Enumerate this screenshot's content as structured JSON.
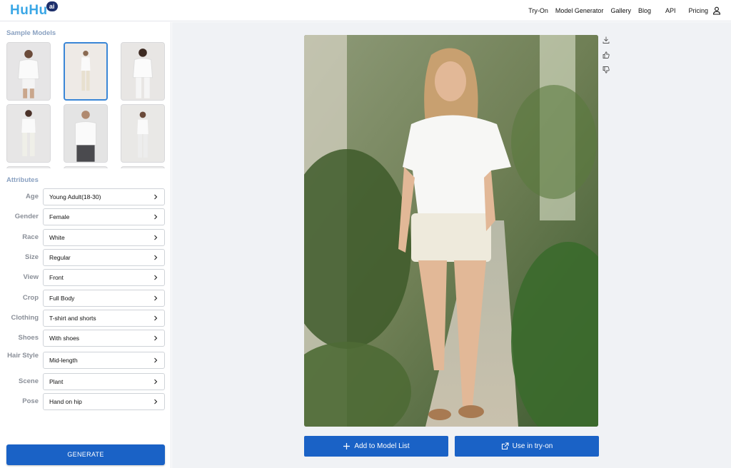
{
  "header": {
    "logo_text": "HuHu",
    "logo_badge": "ai",
    "nav": [
      "Try-On",
      "Model Generator",
      "Gallery",
      "Blog",
      "API",
      "Pricing"
    ]
  },
  "sidebar": {
    "sample_models_title": "Sample Models",
    "attributes_title": "Attributes",
    "attributes": [
      {
        "label": "Age",
        "value": "Young Adult(18-30)"
      },
      {
        "label": "Gender",
        "value": "Female"
      },
      {
        "label": "Race",
        "value": "White"
      },
      {
        "label": "Size",
        "value": "Regular"
      },
      {
        "label": "View",
        "value": "Front"
      },
      {
        "label": "Crop",
        "value": "Full Body"
      },
      {
        "label": "Clothing",
        "value": "T-shirt and shorts"
      },
      {
        "label": "Shoes",
        "value": "With shoes"
      },
      {
        "label": "Hair Style",
        "value": "Mid-length"
      },
      {
        "label": "Scene",
        "value": "Plant"
      },
      {
        "label": "Pose",
        "value": "Hand on hip"
      }
    ],
    "generate_label": "GENERATE"
  },
  "main": {
    "add_label": "Add to Model List",
    "use_label": "Use in try-on"
  },
  "colors": {
    "primary": "#1a62c6",
    "logo": "#3aa7e6",
    "section_title": "#8aa1c1",
    "selected_border": "#3a86d6",
    "canvas_bg": "#f0f2f5"
  },
  "icons": [
    "user-icon",
    "chevron-right-icon",
    "download-icon",
    "thumbs-up-icon",
    "thumbs-down-icon",
    "plus-icon",
    "share-icon"
  ]
}
